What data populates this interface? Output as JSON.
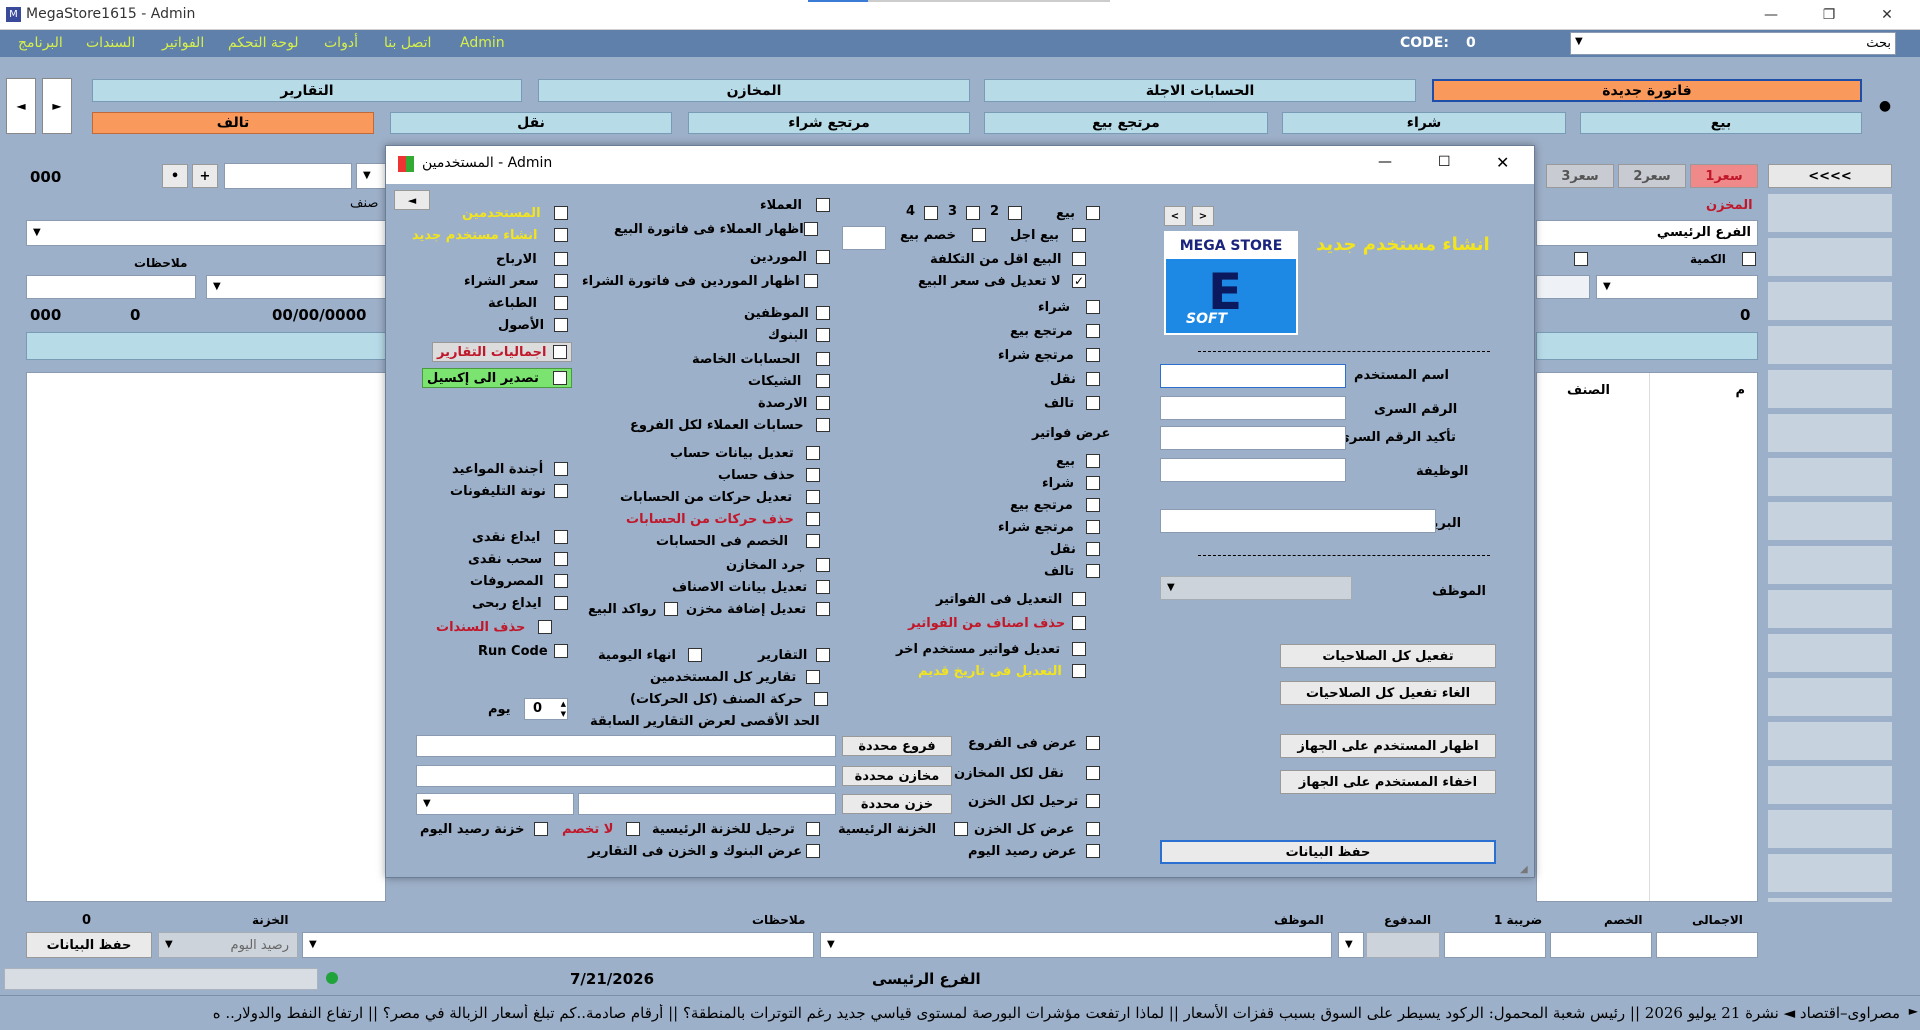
{
  "window": {
    "title": "MegaStore1615 - Admin",
    "min": "—",
    "max": "❐",
    "close": "✕"
  },
  "menu": {
    "items": [
      "البرنامج",
      "السندات",
      "الفواتير",
      "لوحة التحكم",
      "أدوات",
      "اتصل بنا",
      "Admin"
    ],
    "code_label": "CODE:",
    "code_value": "0",
    "search_label": "بحث"
  },
  "top": {
    "reports": "التقارير",
    "stores": "المخازن",
    "deferred": "الحسابات الاجلة",
    "new_invoice": "فاتورة جديدة",
    "damaged": "تالف",
    "transfer": "نقل",
    "purchase_return": "مرتجع شراء",
    "sales_return": "مرتجع بيع",
    "purchase": "شراء",
    "sale": "بيع"
  },
  "main": {
    "num000": "000",
    "price_tabs": [
      "سعر1",
      "سعر2",
      "سعر3"
    ],
    "back_arrows": "<<<<",
    "item_label": "صنف",
    "notes_label": "ملاحظات",
    "store_label": "المخزن",
    "branch_value": "الفرع الرئيسي",
    "qty_label": "الكمية",
    "row_000": "000",
    "row_zero": "0",
    "row_date": "00/00/0000",
    "right_zero": "0",
    "col_m": "م",
    "col_item": "الصنف",
    "plus": "+",
    "dot": "•"
  },
  "bottom": {
    "total": "الاجمالى",
    "discount": "الخصم",
    "tax": "ضريبة 1",
    "paid": "المدفوع",
    "employee": "الموظف",
    "notes": "ملاحظات",
    "safe": "الخزنة",
    "zero": "0",
    "today_balance": "رصيد اليوم",
    "save": "حفظ البيانات",
    "date": "7/21/2026",
    "branch": "الفرع الرئيسى"
  },
  "ticker": "مصراوى–اقتصاد ◄ نشرة 21 يوليو 2026 || رئيس شعبة المحمول: الركود يسيطر على السوق بسبب قفزات الأسعار || لماذا ارتفعت مؤشرات البورصة لمستوى قياسي جديد رغم التوترات بالمنطقة؟ || أرقام صادمة..كم تبلغ أسعار الزبالة في مصر؟ || ارتفاع النفط والدولار.. ه",
  "dialog": {
    "title": "المستخدمين - Admin",
    "heading": "انشاء مستخدم جديد",
    "logo_top": "MEGA STORE",
    "logo_bottom": "SOFT",
    "fields": {
      "username": "اسم المستخدم",
      "password": "الرقم السرى",
      "confirm": "تأكيد الرقم السرى",
      "job": "الوظيفة",
      "email": "البريد",
      "employee": "الموظف"
    },
    "buttons": {
      "enable_all": "تفعيل كل الصلاحيات",
      "disable_all": "الغاء تفعيل كل الصلاحيات",
      "show_user": "اظهار المستخدم على الجهاز",
      "hide_user": "اخفاء المستخدم على الجهاز",
      "save": "حفظ البيانات",
      "specific_branches": "فروع محددة",
      "specific_stores": "مخازن محددة",
      "specific_safes": "خزن محددة"
    },
    "col1": {
      "sale": "بيع",
      "p2": "2",
      "p3": "3",
      "p4": "4",
      "deferred_sale": "بيع اجل",
      "sale_discount": "خصم بيع",
      "below_cost": "البيع اقل من التكلفة",
      "no_edit_price": "لا تعديل فى سعر البيع",
      "purchase": "شراء",
      "sales_return": "مرتجع بيع",
      "purchase_return": "مرتجع شراء",
      "transfer": "نقل",
      "damaged": "تالف",
      "show_invoices": "عرض فواتير",
      "edit_invoices": "التعديل فى الفواتير",
      "delete_items": "حذف اصناف من الفواتير",
      "edit_other_user": "تعديل فواتير مستخدم اخر",
      "edit_old_date": "التعديل فى تاريخ قديم"
    },
    "col2": {
      "customers": "العملاء",
      "show_customers": "اظهار العملاء فى فاتورة البيع",
      "suppliers": "الموردين",
      "show_suppliers": "اظهار الموردين فى فاتورة الشراء",
      "employees": "الموظفين",
      "banks": "البنوك",
      "private_accounts": "الحسابات الخاصة",
      "checks": "الشيكات",
      "balances": "الارصدة",
      "all_branch_customers": "حسابات العملاء لكل الفروع",
      "edit_account": "تعديل بيانات حساب",
      "delete_account": "حذف حساب",
      "edit_account_moves": "تعديل حركات من الحسابات",
      "delete_account_moves": "حذف حركات من الحسابات",
      "discount_accounts": "الخصم فى الحسابات",
      "inventory": "جرد المخازن",
      "edit_items": "تعديل بيانات الاصناف",
      "edit_add_store": "تعديل إضافة مخزن",
      "sale_racks": "رواكد البيع",
      "reports": "التقارير",
      "end_day": "انهاء اليومية",
      "all_users_reports": "تقارير كل المستخدمين",
      "item_movement": "حركة الصنف (كل الحركات)",
      "max_days": "الحد الأقصى لعرض التقارير السابقة",
      "day": "يوم",
      "days_value": "0"
    },
    "col3": {
      "users": "المستخدمين",
      "create_user": "انشاء مستخدم جديد",
      "profits": "الارباح",
      "purchase_price": "سعر الشراء",
      "printing": "الطباعة",
      "assets": "الأصول",
      "report_totals": "اجماليات التقارير",
      "export_excel": "تصدير الى إكسيل",
      "appointments": "أجندة المواعيد",
      "phonebook": "نوتة التليفونات",
      "cash_deposit": "ايداع نقدى",
      "cash_withdraw": "سحب نقدى",
      "expenses": "المصروفات",
      "profit_deposit": "ايداع ربحى",
      "delete_vouchers": "حذف السندات",
      "run_code": "Run Code"
    },
    "bottomrows": {
      "show_branches": "عرض فى الفروع",
      "transfer_stores": "نقل لكل المخازن",
      "transfer_safes": "ترحيل لكل الخزن",
      "show_all_safes": "عرض كل الخزن",
      "show_today_balance": "عرض رصيد اليوم",
      "main_safe": "الخزنة الرئيسية",
      "transfer_main_safe": "ترحيل للخزنة الرئيسية",
      "no_discount": "لا تخصم",
      "today_safe_balance": "خزنة رصيد اليوم",
      "show_banks_safes": "عرض البنوك و الخزن فى التقارير"
    }
  }
}
